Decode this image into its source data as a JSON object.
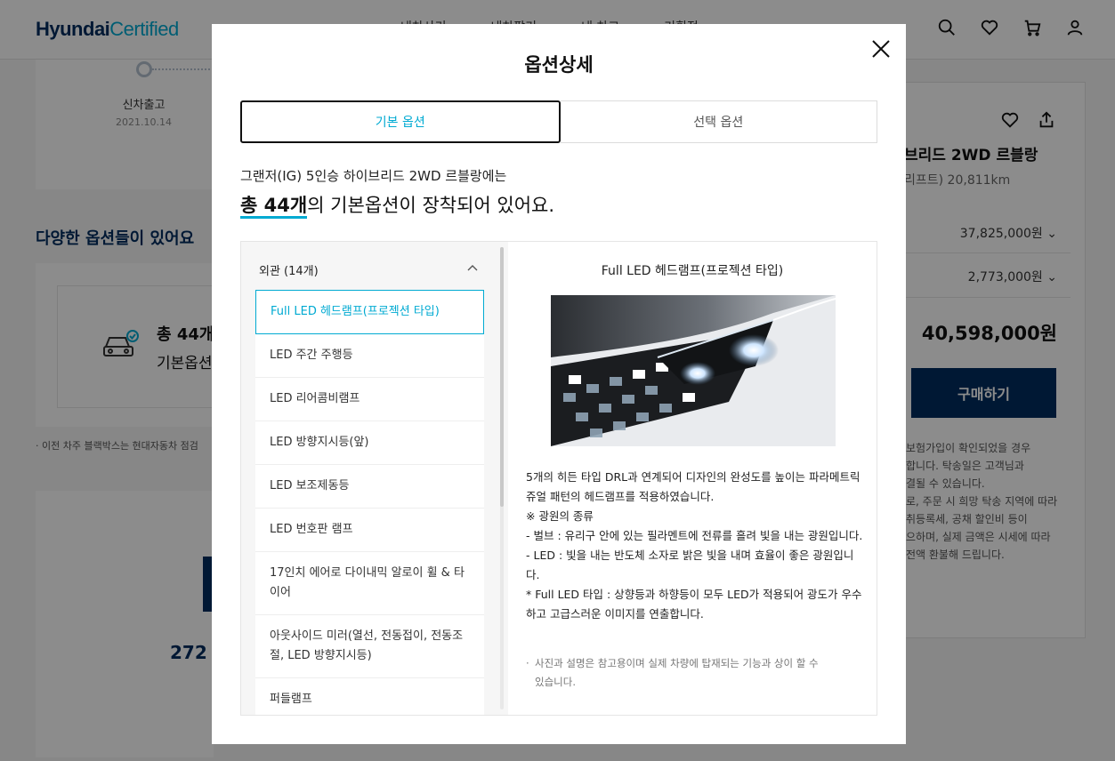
{
  "header": {
    "logo_main": "Hyundai",
    "logo_sub": "Certified",
    "nav": [
      "내차사기",
      "내차팔기",
      "내 차고",
      "기획전"
    ]
  },
  "background": {
    "timeline_label": "신차출고",
    "timeline_date": "2021.10.14",
    "options_title": "다양한 옵션들이 있어요",
    "options_count": "총 44개",
    "options_sub": "기본옵션",
    "note": "·  이전 차주 블랙박스는 현대자동차 점검",
    "stat": "272"
  },
  "sidebar": {
    "title": "브리드 2WD 르블랑",
    "sub": "리프트) 20,811km",
    "price1": "37,825,000원",
    "price2": "2,773,000원",
    "total": "40,598,000원",
    "buy_label": "구매하기",
    "notes": [
      "보험가입이 확인되었을 경우",
      "합니다. 탁송일은 고객님과",
      "결될 수 있습니다.",
      "로, 주문 시 희망 탁송 지역에 따라",
      "",
      "취등록세, 공채 할인비 등이",
      "",
      "으하며, 실제 금액은 시세에 따라",
      "전액 환불해 드립니다."
    ]
  },
  "modal": {
    "title": "옵션상세",
    "tabs": [
      "기본 옵션",
      "선택 옵션"
    ],
    "intro_line": "그랜저(IG) 5인승 하이브리드 2WD 르블랑에는",
    "intro_highlight": "총 44개",
    "intro_rest": "의 기본옵션이 장착되어 있어요.",
    "category": "외관 (14개)",
    "items": [
      "Full LED 헤드램프(프로젝션 타입)",
      "LED 주간 주행등",
      "LED 리어콤비램프",
      "LED 방향지시등(앞)",
      "LED 보조제동등",
      "LED 번호판 램프",
      "17인치 에어로 다이내믹 알로이 휠 & 타이어",
      "아웃사이드 미러(열선, 전동접이, 전동조절, LED 방향지시등)",
      "퍼들램프",
      ""
    ],
    "detail_title": "Full LED 헤드램프(프로젝션 타입)",
    "detail_desc": [
      "5개의 히든 타입 DRL과 연계되어 디자인의 완성도를 높이는 파라메트릭 쥬얼 패턴의 헤드램프를 적용하였습니다.",
      "※ 광원의 종류",
      "- 벌브 : 유리구 안에 있는 필라멘트에 전류를 흘려 빛을 내는 광원입니다.",
      "- LED : 빛을 내는 반도체 소자로 밝은 빛을 내며 효율이 좋은 광원입니다.",
      "* Full LED 타입 : 상향등과 하향등이 모두 LED가 적용되어 광도가 우수하고 고급스러운 이미지를 연출합니다."
    ],
    "detail_note": "사진과 설명은 참고용이며 실제 차량에 탑재되는 기능과 상이 할 수 있습니다."
  }
}
